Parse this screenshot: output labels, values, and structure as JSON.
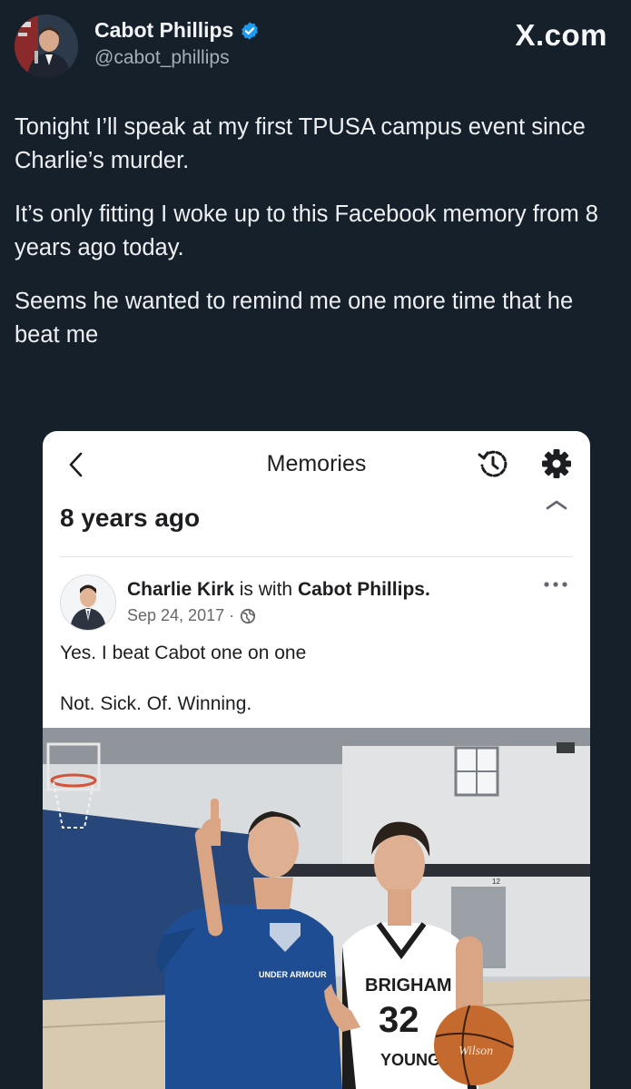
{
  "tweet": {
    "author": {
      "display_name": "Cabot Phillips",
      "handle": "@cabot_phillips",
      "verified": true
    },
    "site_label": "X.com",
    "paragraphs": [
      "Tonight I’ll speak at my first TPUSA campus event since Charlie’s murder.",
      "It’s only fitting I woke up to this Facebook memory from 8 years ago today.",
      "Seems he wanted to remind me one more time that he beat me"
    ]
  },
  "memory": {
    "title": "Memories",
    "section_heading": "8 years ago",
    "post": {
      "author": "Charlie Kirk",
      "with_text": "is with",
      "tagged": "Cabot Phillips.",
      "date": "Sep 24, 2017",
      "separator": "·",
      "text_line1": "Yes. I beat Cabot one on one",
      "text_line2": "Not. Sick. Of. Winning."
    },
    "photo_text": {
      "shirt_brand": "UNDER ARMOUR",
      "jersey_name": "BRIGHAM",
      "jersey_number": "32",
      "jersey_name2": "YOUNG",
      "ball_brand": "Wilson",
      "wall_number": "12"
    }
  },
  "icons": [
    "verified-badge-icon",
    "back-chevron-icon",
    "history-icon",
    "gear-icon",
    "chevron-up-icon",
    "globe-icon",
    "more-options-icon"
  ],
  "colors": {
    "background": "#15202b",
    "verified_blue": "#1d9bf0",
    "card_bg": "#ffffff"
  }
}
